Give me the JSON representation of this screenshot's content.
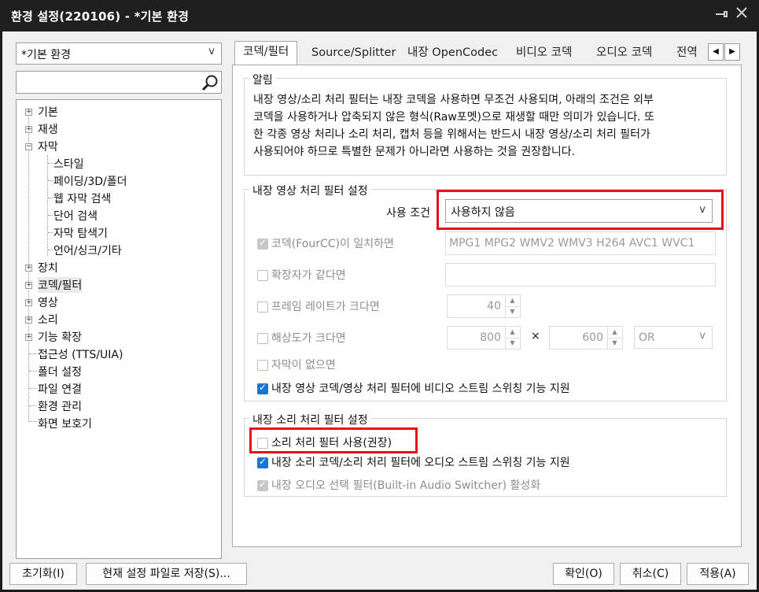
{
  "window": {
    "title": "환경 설정(220106) - *기본 환경"
  },
  "preset": {
    "value": "*기본 환경"
  },
  "search": {
    "value": ""
  },
  "tree": {
    "items": [
      "기본",
      "재생",
      "자막",
      "스타일",
      "페이딩/3D/폴더",
      "웹 자막 검색",
      "단어 검색",
      "자막 탐색기",
      "언어/싱크/기타",
      "장치",
      "코덱/필터",
      "영상",
      "소리",
      "기능 확장",
      "접근성 (TTS/UIA)",
      "폴더 설정",
      "파일 연결",
      "환경 관리",
      "화면 보호기"
    ]
  },
  "tabs": [
    "코덱/필터",
    "Source/Splitter",
    "내장 OpenCodec",
    "비디오 코덱",
    "오디오 코덱",
    "전역"
  ],
  "notice": {
    "title": "알림",
    "lines": [
      "내장 영상/소리 처리 필터는 내장 코덱을 사용하면 무조건 사용되며, 아래의 조건은 외부",
      "코덱을 사용하거나 압축되지 않은 형식(Raw포멧)으로 재생할 때만 의미가 있습니다. 또",
      "한 각종 영상 처리나 소리 처리, 캡처 등을 위해서는 반드시 내장 영상/소리 처리 필터가",
      "사용되어야 하므로 특별한 문제가 아니라면 사용하는 것을 권장합니다."
    ]
  },
  "video_filter": {
    "title": "내장 영상 처리 필터 설정",
    "use_condition_label": "사용 조건",
    "use_condition_value": "사용하지 않음",
    "codec_label": "코덱(FourCC)이 일치하면",
    "codec_value": "MPG1 MPG2 WMV2 WMV3 H264 AVC1 WVC1",
    "ext_label": "확장자가 같다면",
    "ext_value": "",
    "framerate_label": "프레임 레이트가 크다면",
    "framerate_value": "40",
    "resolution_label": "해상도가 크다면",
    "res_w": "800",
    "res_x": "×",
    "res_h": "600",
    "res_op": "OR",
    "nosub_label": "자막이 없으면",
    "stream_switch_label": "내장 영상 코덱/영상 처리 필터에 비디오 스트림 스위칭 기능 지원"
  },
  "audio_filter": {
    "title": "내장 소리 처리 필터 설정",
    "use_label": "소리 처리 필터 사용(권장)",
    "stream_switch_label": "내장 소리 코덱/소리 처리 필터에 오디오 스트림 스위칭 기능 지원",
    "switcher_label": "내장 오디오 선택 필터(Built-in Audio Switcher) 활성화"
  },
  "buttons": {
    "reset": "초기화(I)",
    "save_as": "현재 설정 파일로 저장(S)...",
    "ok": "확인(O)",
    "cancel": "취소(C)",
    "apply": "적용(A)"
  },
  "colors": {
    "highlight": "#e3121b",
    "checked": "#1976d2"
  }
}
